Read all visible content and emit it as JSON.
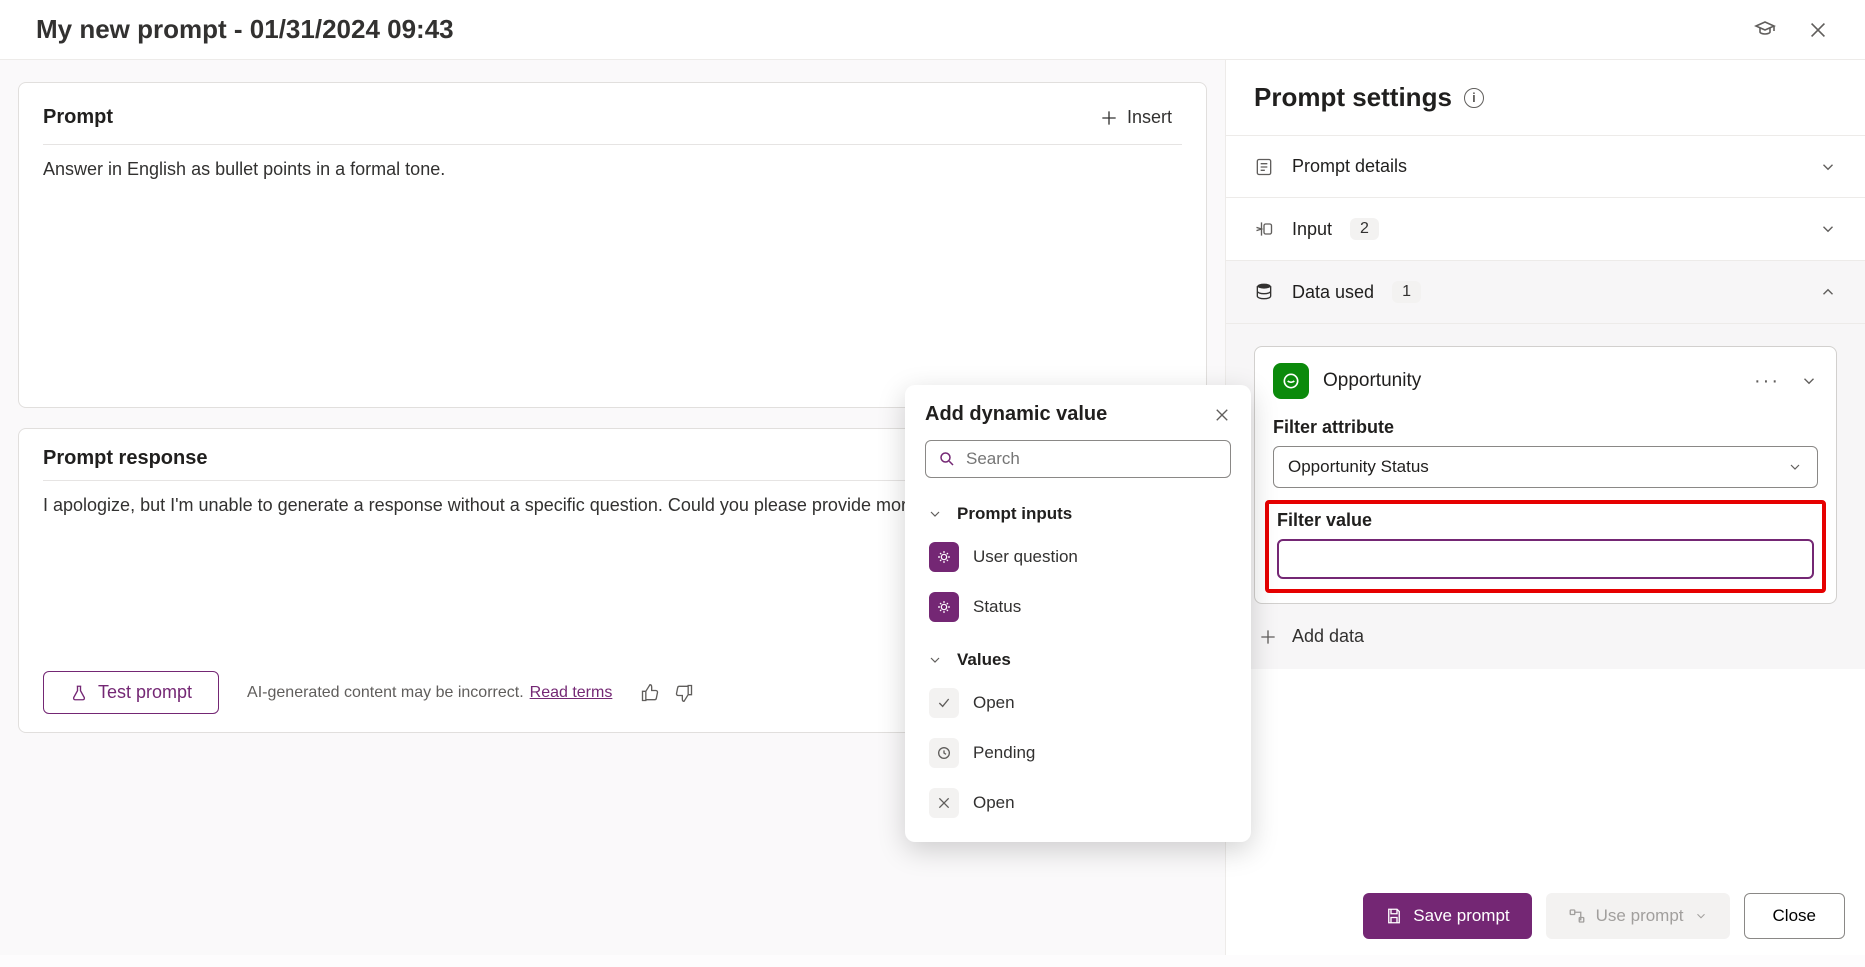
{
  "header": {
    "title": "My new prompt - 01/31/2024 09:43"
  },
  "prompt": {
    "section_title": "Prompt",
    "insert_label": "Insert",
    "text": "Answer in English as bullet points in a formal tone."
  },
  "response": {
    "section_title": "Prompt response",
    "text": "I apologize, but I'm unable to generate a response without a specific question. Could you please provide more de"
  },
  "footer": {
    "test_label": "Test prompt",
    "disclaimer": "AI-generated content may be incorrect.",
    "read_terms": "Read terms"
  },
  "settings": {
    "title": "Prompt settings",
    "details_label": "Prompt details",
    "input_label": "Input",
    "input_count": "2",
    "data_used_label": "Data used",
    "data_used_count": "1"
  },
  "data_card": {
    "entity": "Opportunity",
    "filter_attr_label": "Filter attribute",
    "filter_attr_value": "Opportunity Status",
    "filter_value_label": "Filter value",
    "filter_value": ""
  },
  "add_data_label": "Add data",
  "buttons": {
    "save": "Save prompt",
    "use": "Use prompt",
    "close": "Close"
  },
  "popup": {
    "title": "Add dynamic value",
    "search_placeholder": "Search",
    "group_inputs": "Prompt inputs",
    "group_values": "Values",
    "inputs": [
      {
        "label": "User question"
      },
      {
        "label": "Status"
      }
    ],
    "values": [
      {
        "icon": "check",
        "label": "Open"
      },
      {
        "icon": "clock",
        "label": "Pending"
      },
      {
        "icon": "x",
        "label": "Open"
      }
    ]
  }
}
